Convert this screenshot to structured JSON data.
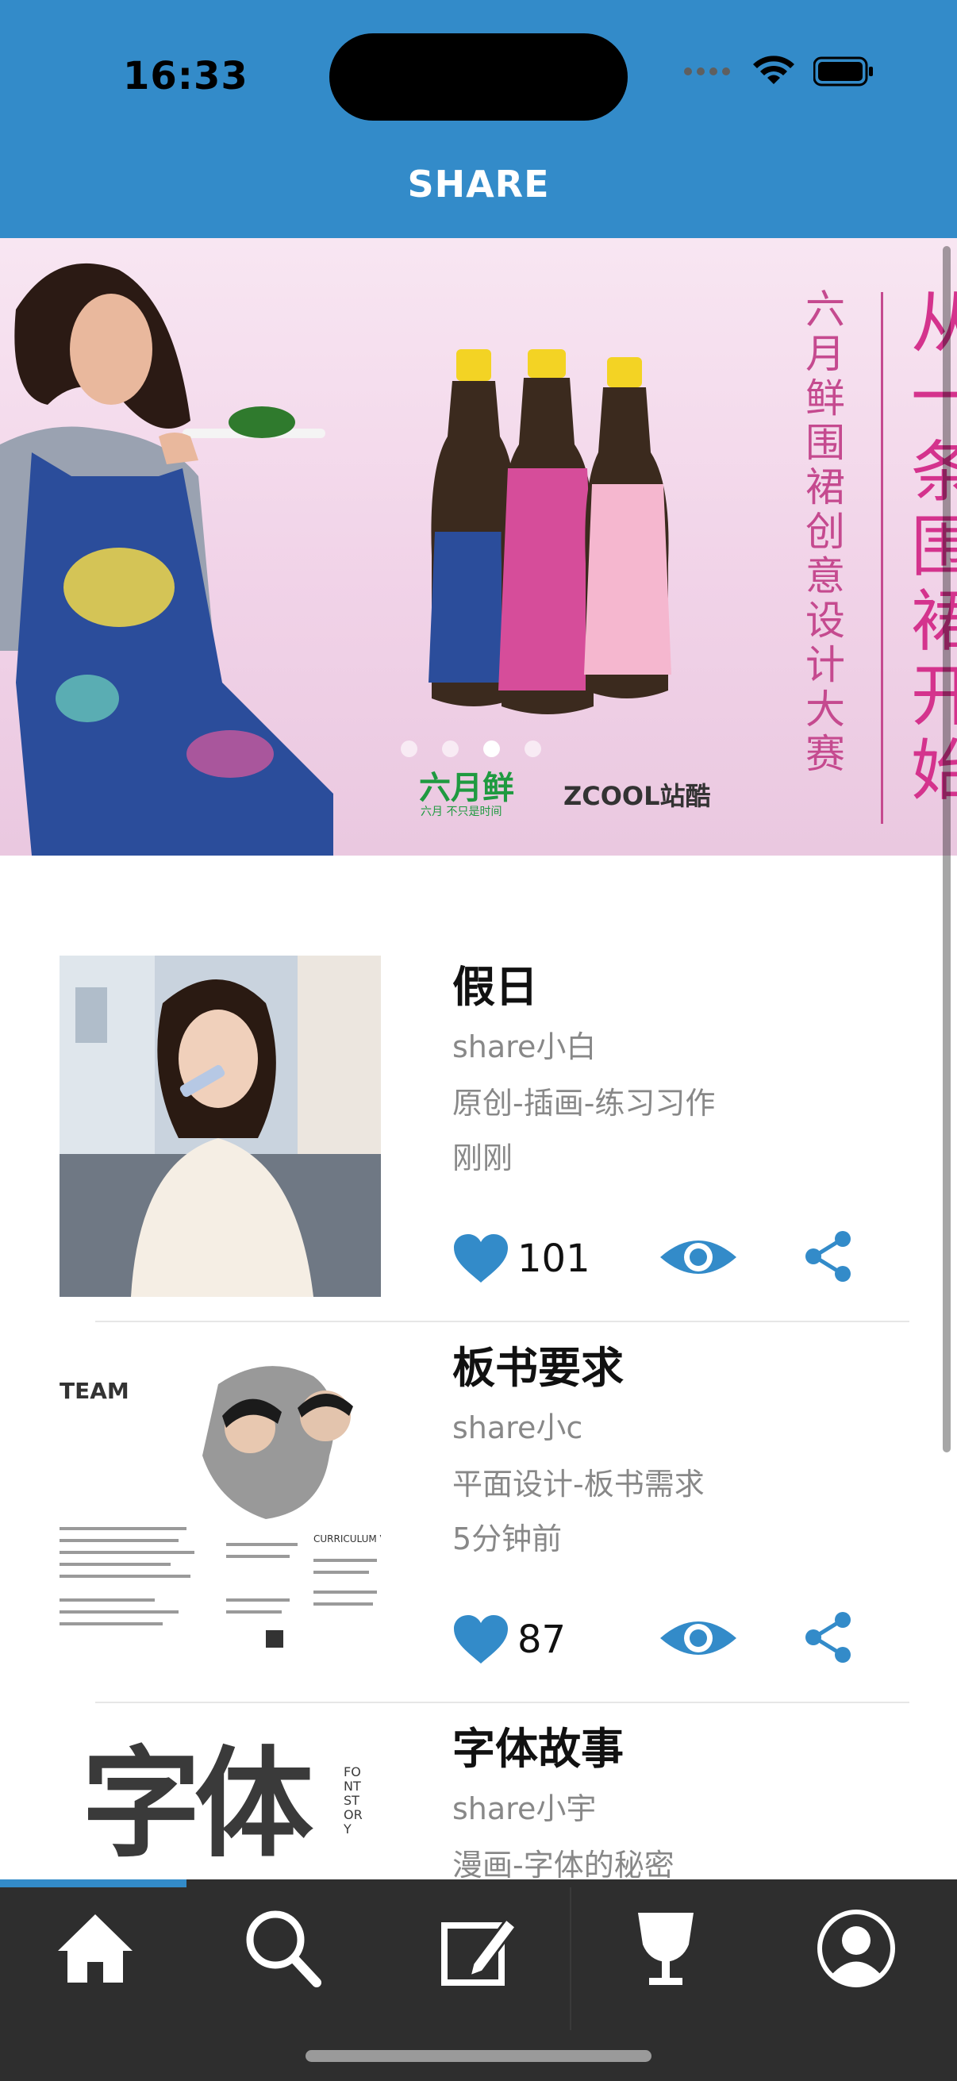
{
  "status_bar": {
    "time": "16:33"
  },
  "nav": {
    "title": "SHARE"
  },
  "banner": {
    "vertical_title": "六月鲜围裙创意设计大赛",
    "vertical_slogan": "从一条围裙开始",
    "brand_left": "六月鲜",
    "brand_left_sub": "六月 不只是时间",
    "brand_right": "ZCOOL站酷",
    "page_count": 4,
    "active_page": 3
  },
  "feed": [
    {
      "title": "假日",
      "user": "share小白",
      "category": "原创-插画-练习习作",
      "time": "刚刚",
      "likes": "101"
    },
    {
      "title": "板书要求",
      "user": "share小c",
      "category": "平面设计-板书需求",
      "time": "5分钟前",
      "likes": "87"
    },
    {
      "title": "字体故事",
      "user": "share小宇",
      "category": "漫画-字体的秘密",
      "time": "",
      "likes": ""
    }
  ],
  "thumb_text": {
    "team": "TEAM",
    "cv": "CURRICULUM V",
    "font_big": "字体",
    "font_story": "FONT STORY"
  },
  "tabs": [
    {
      "icon": "home-icon"
    },
    {
      "icon": "search-icon"
    },
    {
      "icon": "compose-icon"
    },
    {
      "icon": "trophy-icon"
    },
    {
      "icon": "profile-icon"
    }
  ],
  "colors": {
    "accent": "#338bc9",
    "tabbar": "#2e2e2e",
    "banner_text": "#c54a8f"
  }
}
